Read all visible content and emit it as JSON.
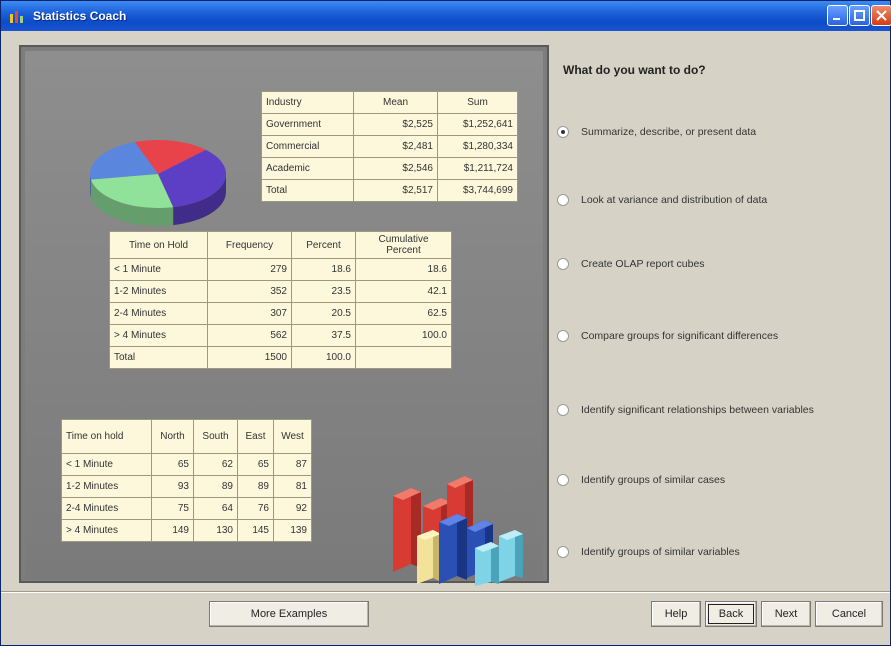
{
  "window": {
    "title": "Statistics Coach"
  },
  "table_industry": {
    "headers": [
      "Industry",
      "Mean",
      "Sum"
    ],
    "rows": [
      [
        "Government",
        "$2,525",
        "$1,252,641"
      ],
      [
        "Commercial",
        "$2,481",
        "$1,280,334"
      ],
      [
        "Academic",
        "$2,546",
        "$1,211,724"
      ],
      [
        "Total",
        "$2,517",
        "$3,744,699"
      ]
    ]
  },
  "table_hold": {
    "headers": [
      "Time on Hold",
      "Frequency",
      "Percent",
      "Cumulative Percent"
    ],
    "rows": [
      [
        "< 1 Minute",
        "279",
        "18.6",
        "18.6"
      ],
      [
        "1-2 Minutes",
        "352",
        "23.5",
        "42.1"
      ],
      [
        "2-4 Minutes",
        "307",
        "20.5",
        "62.5"
      ],
      [
        "> 4 Minutes",
        "562",
        "37.5",
        "100.0"
      ],
      [
        "Total",
        "1500",
        "100.0",
        ""
      ]
    ]
  },
  "table_region": {
    "headers": [
      "Time on hold",
      "North",
      "South",
      "East",
      "West"
    ],
    "rows": [
      [
        "< 1 Minute",
        "65",
        "62",
        "65",
        "87"
      ],
      [
        "1-2 Minutes",
        "93",
        "89",
        "89",
        "81"
      ],
      [
        "2-4 Minutes",
        "75",
        "64",
        "76",
        "92"
      ],
      [
        "> 4 Minutes",
        "149",
        "130",
        "145",
        "139"
      ]
    ]
  },
  "pie": {
    "slices": [
      {
        "color": "#e8424a",
        "frac": 0.18
      },
      {
        "color": "#5c3fc4",
        "frac": 0.34
      },
      {
        "color": "#90e29a",
        "frac": 0.26
      },
      {
        "color": "#5b86de",
        "frac": 0.22
      }
    ]
  },
  "panel": {
    "question": "What do you want to do?",
    "options": [
      {
        "label": "Summarize, describe, or present data",
        "checked": true
      },
      {
        "label": "Look at variance and distribution of data",
        "checked": false
      },
      {
        "label": "Create OLAP report cubes",
        "checked": false
      },
      {
        "label": "Compare groups for significant differences",
        "checked": false
      },
      {
        "label": "Identify significant relationships between variables",
        "checked": false
      },
      {
        "label": "Identify groups of similar cases",
        "checked": false
      },
      {
        "label": "Identify groups of similar variables",
        "checked": false
      }
    ]
  },
  "buttons": {
    "more_examples": "More Examples",
    "help": "Help",
    "back": "Back",
    "next": "Next",
    "cancel": "Cancel"
  },
  "colors": {
    "titlebar": "#1c5fd8",
    "panel": "#7d7d7d",
    "table": "#fdf7dc"
  }
}
